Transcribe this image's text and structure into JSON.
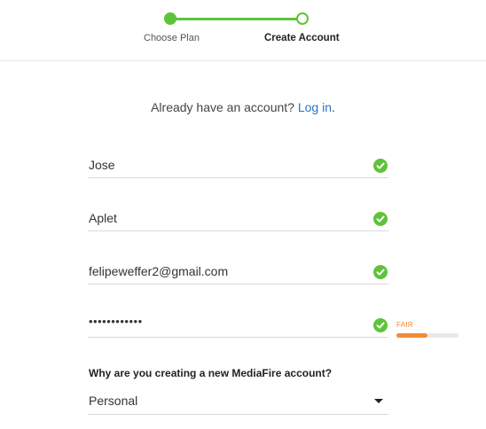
{
  "stepper": {
    "steps": [
      {
        "label": "Choose Plan",
        "state": "completed"
      },
      {
        "label": "Create Account",
        "state": "current"
      }
    ],
    "accent_color": "#5fc33a"
  },
  "login_prompt": {
    "text": "Already have an account?",
    "link_label": "Log in",
    "suffix": "."
  },
  "form": {
    "fields": [
      {
        "name": "first_name",
        "value": "Jose",
        "valid": true
      },
      {
        "name": "last_name",
        "value": "Aplet",
        "valid": true
      },
      {
        "name": "email",
        "value": "felipeweffer2@gmail.com",
        "valid": true
      },
      {
        "name": "password",
        "value": "••••••••••••",
        "valid": true
      }
    ],
    "password_strength": {
      "label": "FAIR",
      "level": 0.5,
      "color": "#f28c38"
    },
    "reason": {
      "question": "Why are you creating a new MediaFire account?",
      "selected": "Personal"
    }
  },
  "icons": {
    "valid": "check-circle-icon",
    "dropdown": "caret-down-icon"
  }
}
